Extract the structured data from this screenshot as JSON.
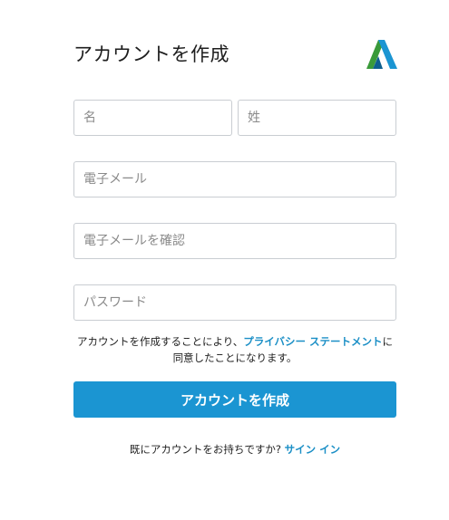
{
  "header": {
    "title": "アカウントを作成"
  },
  "logo": {
    "icon": "autodesk-logo-icon",
    "colors": [
      "#3a9a3a",
      "#1b95d2",
      "#0d5f8f"
    ]
  },
  "form": {
    "given_name": {
      "placeholder": "名",
      "value": ""
    },
    "family_name": {
      "placeholder": "姓",
      "value": ""
    },
    "email": {
      "placeholder": "電子メール",
      "value": ""
    },
    "email_confirm": {
      "placeholder": "電子メールを確認",
      "value": ""
    },
    "password": {
      "placeholder": "パスワード",
      "value": ""
    }
  },
  "terms": {
    "prefix": "アカウントを作成することにより、",
    "link": "プライバシー ステートメント",
    "suffix": "に同意したことになります。"
  },
  "create_button": {
    "label": "アカウントを作成",
    "color": "#1b95d2"
  },
  "signin": {
    "text": "既にアカウントをお持ちですか? ",
    "link": "サイン イン"
  }
}
